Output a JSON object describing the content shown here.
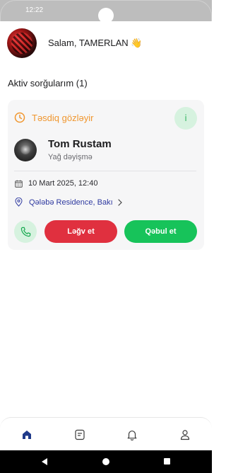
{
  "status_bar": {
    "time": "12:22"
  },
  "header": {
    "greeting": "Salam, TAMERLAN 👋"
  },
  "section": {
    "title": "Aktiv sorğularım (1)"
  },
  "request": {
    "status": "Təsdiq gözləyir",
    "info_label": "i",
    "person_name": "Tom Rustam",
    "service": "Yağ dəyişmə",
    "datetime": "10 Mart 2025, 12:40",
    "address": "Qələbə Residence, Bakı",
    "cancel_label": "Ləğv et",
    "accept_label": "Qəbul et"
  },
  "tabbar": {
    "items": [
      {
        "icon": "home-icon",
        "active": true
      },
      {
        "icon": "requests-icon",
        "active": false
      },
      {
        "icon": "bell-icon",
        "active": false
      },
      {
        "icon": "profile-icon",
        "active": false
      }
    ]
  },
  "colors": {
    "pending": "#f0962e",
    "accept": "#17c35a",
    "cancel": "#e0303f",
    "active_tab": "#1f3a8a"
  }
}
